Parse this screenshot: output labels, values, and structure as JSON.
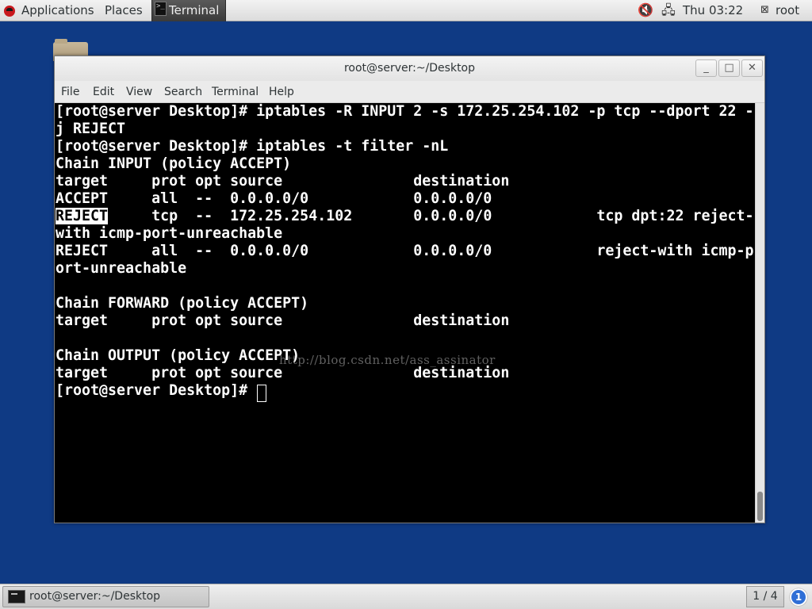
{
  "top_panel": {
    "applications": "Applications",
    "places": "Places",
    "active_app": "Terminal",
    "clock": "Thu 03:22",
    "user": "root"
  },
  "window": {
    "title": "root@server:~/Desktop",
    "controls": {
      "minimize": "_",
      "maximize": "□",
      "close": "✕"
    }
  },
  "menubar": {
    "items": [
      "File",
      "Edit",
      "View",
      "Search",
      "Terminal",
      "Help"
    ]
  },
  "terminal": {
    "lines": [
      "[root@server Desktop]# iptables -R INPUT 2 -s 172.25.254.102 -p tcp --dport 22 -",
      "j REJECT",
      "[root@server Desktop]# iptables -t filter -nL",
      "Chain INPUT (policy ACCEPT)",
      "target     prot opt source               destination         ",
      "ACCEPT     all  --  0.0.0.0/0            0.0.0.0/0           ",
      "tcp  --  172.25.254.102       0.0.0.0/0            tcp dpt:22 reject-",
      "with icmp-port-unreachable",
      "REJECT     all  --  0.0.0.0/0            0.0.0.0/0            reject-with icmp-p",
      "ort-unreachable",
      "",
      "Chain FORWARD (policy ACCEPT)",
      "target     prot opt source               destination         ",
      "",
      "Chain OUTPUT (policy ACCEPT)",
      "target     prot opt source               destination         ",
      "[root@server Desktop]# "
    ],
    "selected_text": "REJECT",
    "watermark": "http://blog.csdn.net/ass_assinator"
  },
  "bottom_panel": {
    "task_label": "root@server:~/Desktop",
    "workspace": "1 / 4",
    "info_icon_glyph": "1"
  },
  "icons": {
    "os_logo": "fedora-icon",
    "volume": "volume-muted-icon",
    "network": "network-icon",
    "user": "user-icon",
    "terminal": "terminal-icon"
  }
}
